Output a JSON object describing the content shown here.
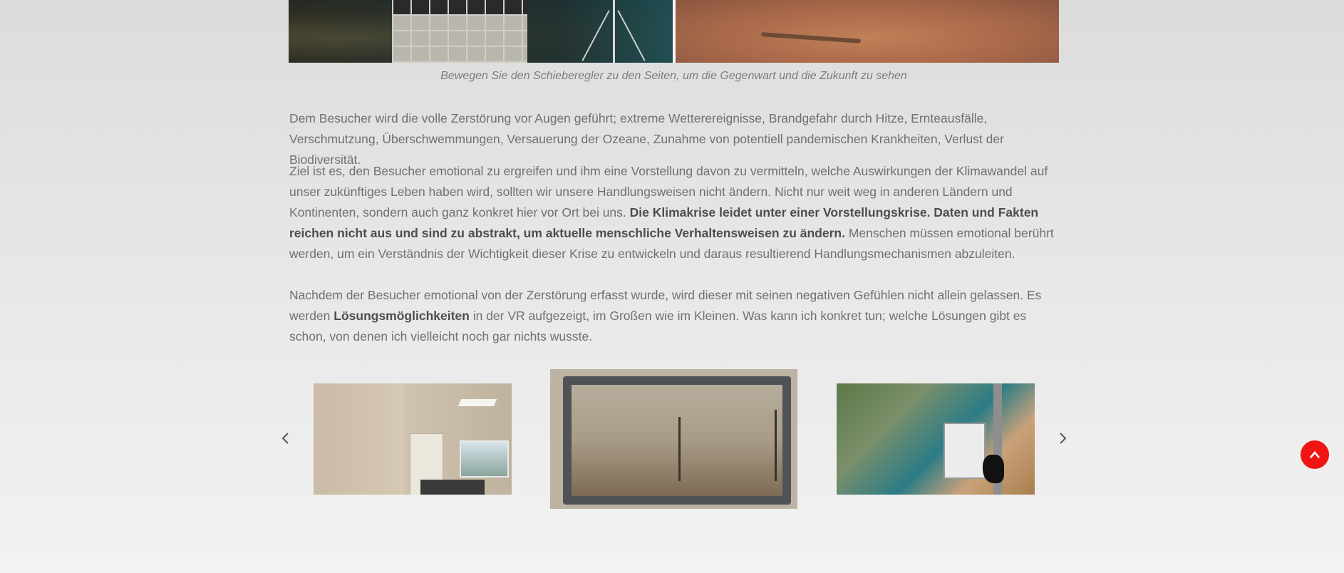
{
  "slider": {
    "caption": "Bewegen Sie den Schieberegler zu den Seiten, um die Gegenwart und die Zukunft zu sehen"
  },
  "content": {
    "p1": "Dem Besucher wird die volle Zerstörung vor Augen geführt; extreme Wetterereignisse, Brandgefahr durch Hitze, Ernteausfälle, Verschmutzung, Überschwemmungen, Versauerung der Ozeane, Zunahme von potentiell pandemischen Krankheiten, Verlust der Biodiversität.",
    "p2_a": "Ziel ist es, den Besucher emotional zu ergreifen und ihm eine Vorstellung davon zu vermitteln, welche Auswirkungen der Klimawandel auf unser zukünftiges Leben haben wird, sollten wir unsere Handlungsweisen nicht ändern. Nicht nur weit weg in anderen Ländern und Kontinenten, sondern auch ganz konkret hier vor Ort bei uns. ",
    "p2_bold": "Die Klimakrise leidet unter einer Vorstellungskrise. Daten und Fakten reichen nicht aus und sind zu abstrakt, um aktuelle menschliche Verhaltensweisen zu ändern.",
    "p2_b": " Menschen müssen emotional berührt werden, um ein Verständnis der Wichtigkeit dieser Krise zu entwickeln und daraus resultierend Handlungsmechanismen abzuleiten.",
    "p3_a": "Nachdem der Besucher emotional von der Zerstörung erfasst wurde, wird dieser mit seinen negativen Gefühlen nicht allein gelassen. Es werden ",
    "p3_bold": "Lösungsmöglichkeiten",
    "p3_b": " in der VR aufgezeigt, im Großen wie im Kleinen. Was kann ich konkret tun; welche Lösungen gibt es schon, von denen ich vielleicht noch gar nichts wusste."
  },
  "carousel": {
    "prev_icon": "chevron-left-icon",
    "next_icon": "chevron-right-icon",
    "active_index": 1,
    "slide_count": 3
  },
  "back_to_top": {
    "icon": "chevron-up-icon",
    "color": "#f01414"
  }
}
